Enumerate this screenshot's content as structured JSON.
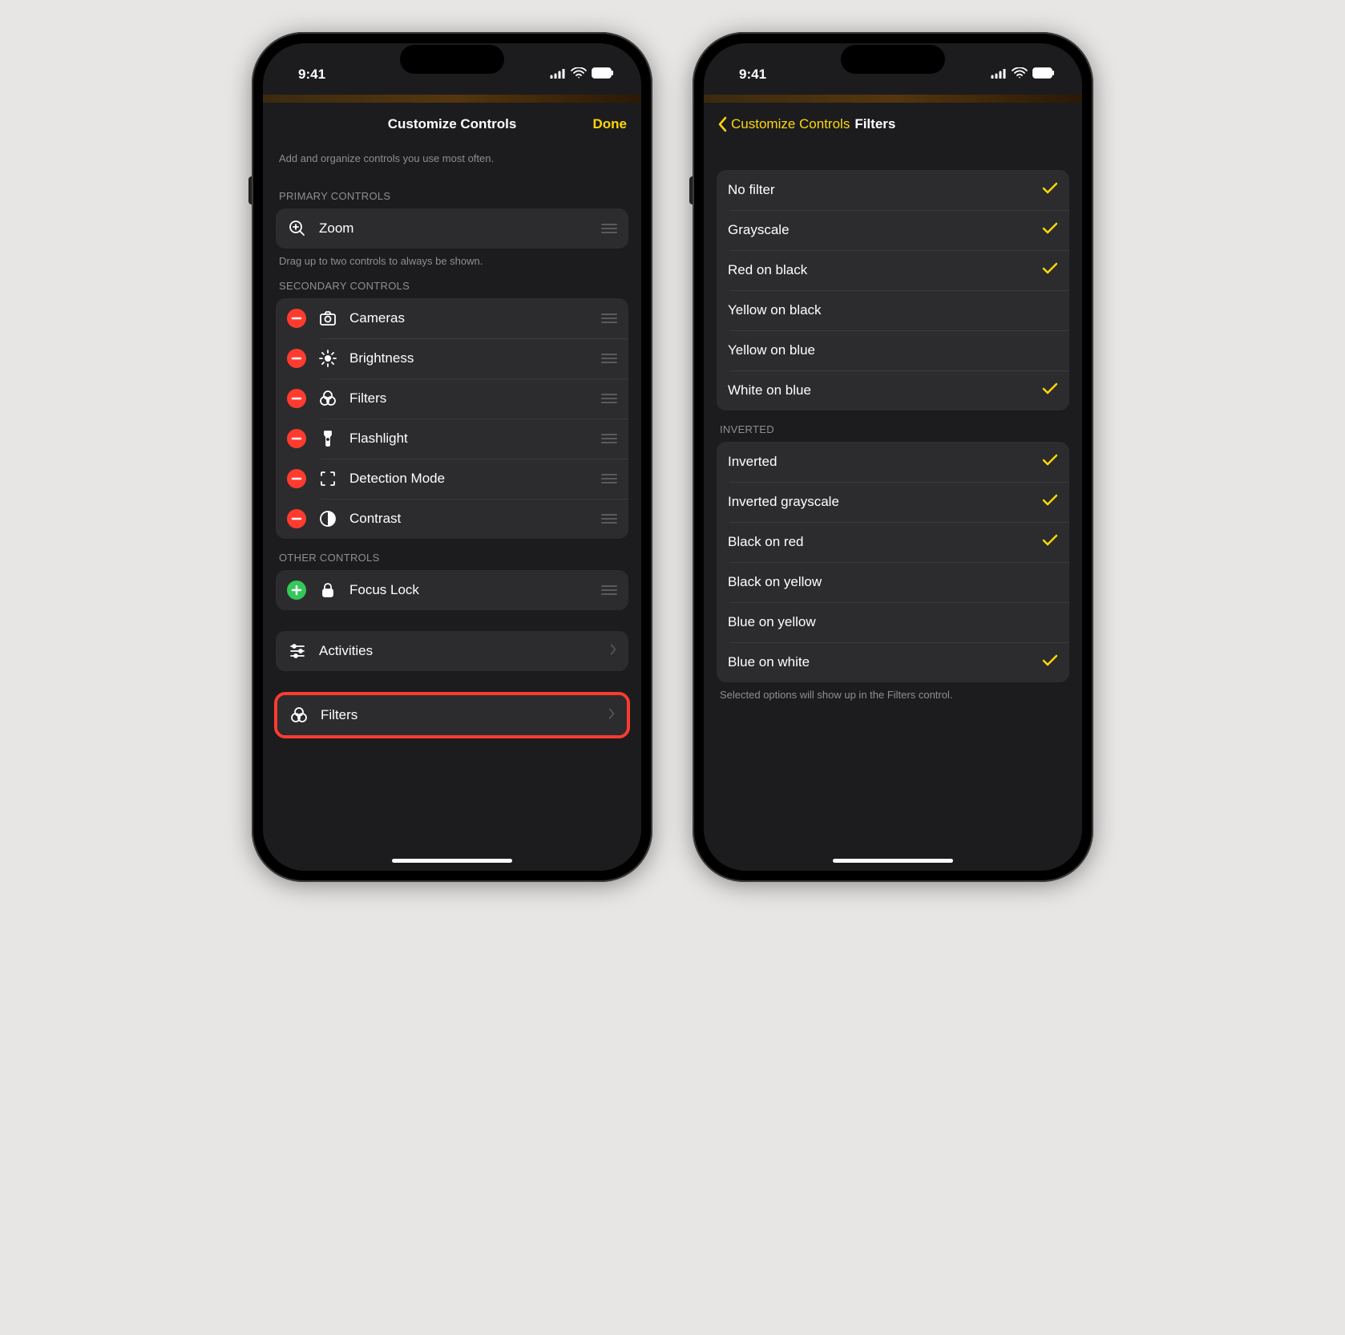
{
  "status": {
    "time": "9:41"
  },
  "left": {
    "nav": {
      "title": "Customize Controls",
      "done": "Done"
    },
    "hint_top": "Add and organize controls you use most often.",
    "primary": {
      "header": "PRIMARY CONTROLS",
      "items": [
        {
          "label": "Zoom"
        }
      ],
      "footer": "Drag up to two controls to always be shown."
    },
    "secondary": {
      "header": "SECONDARY CONTROLS",
      "items": [
        {
          "label": "Cameras"
        },
        {
          "label": "Brightness"
        },
        {
          "label": "Filters"
        },
        {
          "label": "Flashlight"
        },
        {
          "label": "Detection Mode"
        },
        {
          "label": "Contrast"
        }
      ]
    },
    "other": {
      "header": "OTHER CONTROLS",
      "items": [
        {
          "label": "Focus Lock"
        }
      ]
    },
    "activities": {
      "label": "Activities"
    },
    "filters": {
      "label": "Filters"
    }
  },
  "right": {
    "nav": {
      "back": "Customize Controls",
      "title": "Filters"
    },
    "group1": [
      {
        "label": "No filter",
        "checked": true
      },
      {
        "label": "Grayscale",
        "checked": true
      },
      {
        "label": "Red on black",
        "checked": true
      },
      {
        "label": "Yellow on black",
        "checked": false
      },
      {
        "label": "Yellow on blue",
        "checked": false
      },
      {
        "label": "White on blue",
        "checked": true
      }
    ],
    "invertedHeader": "INVERTED",
    "group2": [
      {
        "label": "Inverted",
        "checked": true
      },
      {
        "label": "Inverted grayscale",
        "checked": true
      },
      {
        "label": "Black on red",
        "checked": true
      },
      {
        "label": "Black on yellow",
        "checked": false
      },
      {
        "label": "Blue on yellow",
        "checked": false
      },
      {
        "label": "Blue on white",
        "checked": true
      }
    ],
    "footer": "Selected options will show up in the Filters control."
  }
}
